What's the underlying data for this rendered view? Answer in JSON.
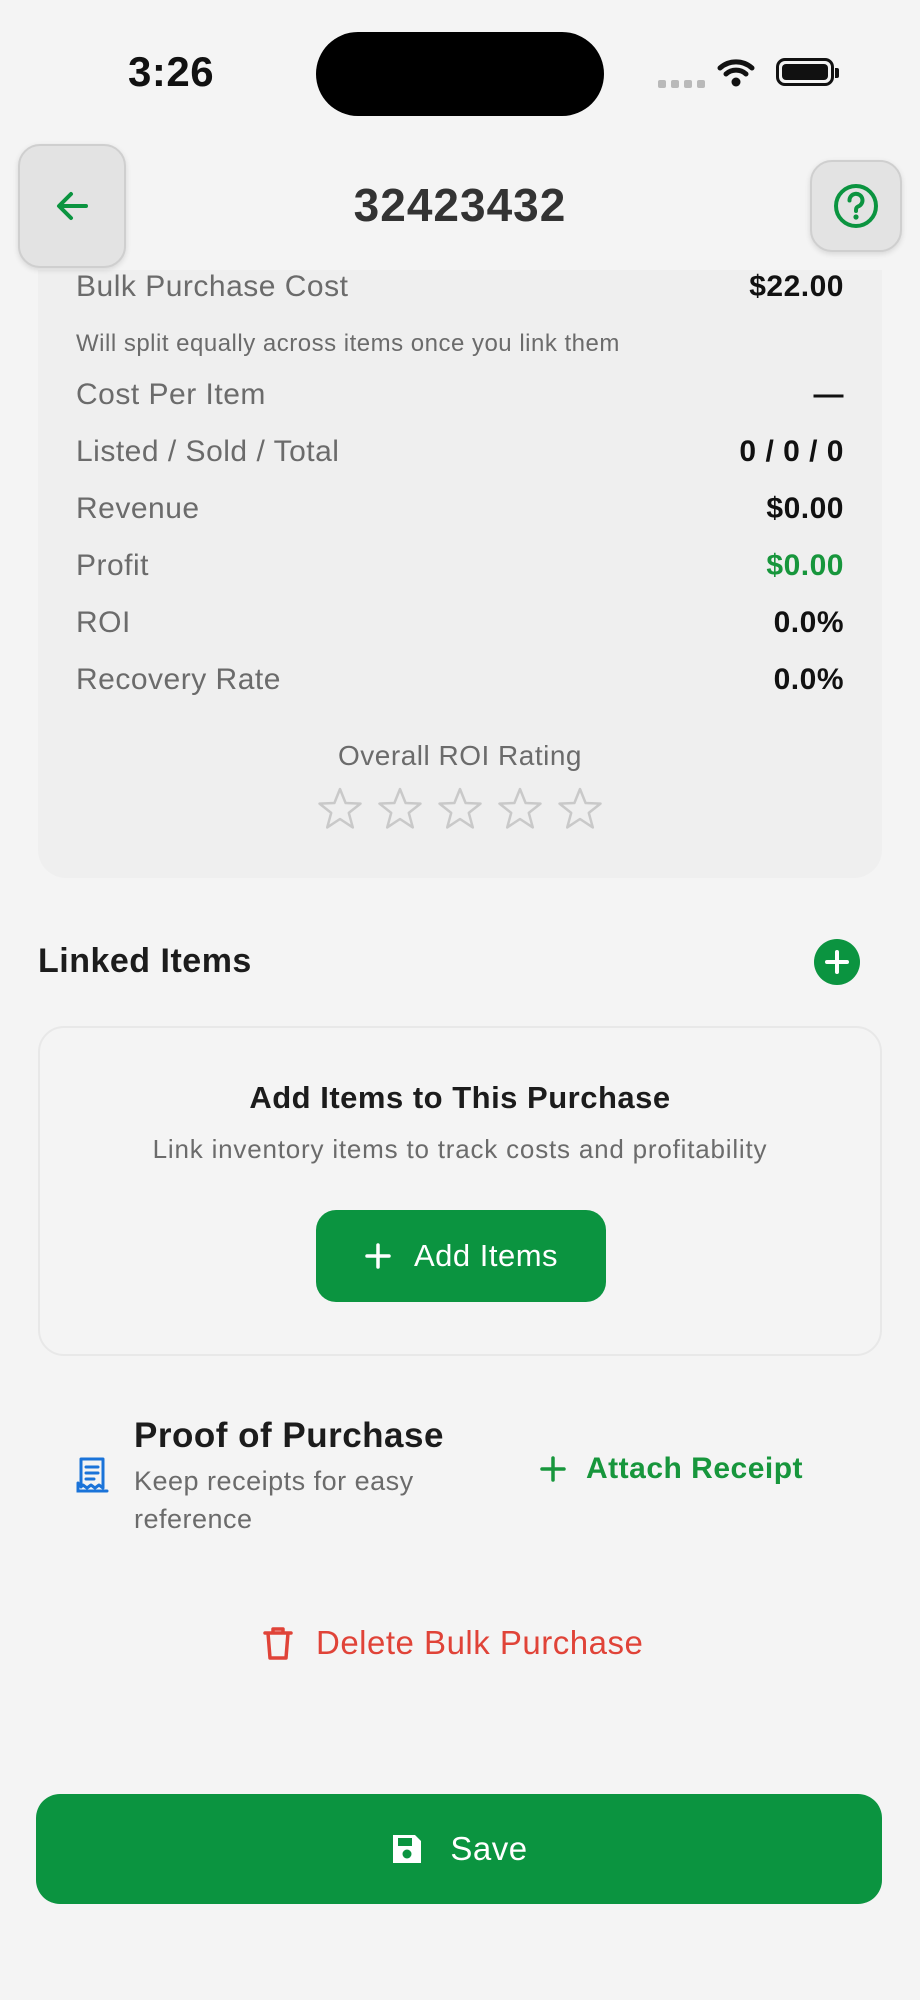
{
  "status_bar": {
    "time": "3:26"
  },
  "header": {
    "title": "32423432",
    "back_icon": "arrow-left-icon",
    "help_icon": "question-circle-icon"
  },
  "colors": {
    "brand_green": "#0b9440",
    "profit_green": "#17963c",
    "danger_red": "#e04338",
    "star_gray": "#c9c9c9"
  },
  "stats": {
    "bulk_cost": {
      "label": "Bulk Purchase Cost",
      "value": "$22.00"
    },
    "split_note": "Will split equally across items once you link them",
    "rows": [
      {
        "label": "Cost Per Item",
        "value": "—"
      },
      {
        "label": "Listed / Sold / Total",
        "value": "0 / 0 / 0"
      },
      {
        "label": "Revenue",
        "value": "$0.00"
      },
      {
        "label": "Profit",
        "value": "$0.00"
      },
      {
        "label": "ROI",
        "value": "0.0%"
      },
      {
        "label": "Recovery Rate",
        "value": "0.0%"
      }
    ],
    "roi_rating": {
      "label": "Overall ROI Rating",
      "stars_filled": 0,
      "stars_total": 5
    }
  },
  "linked_items": {
    "title": "Linked Items",
    "add_icon": "plus-circle-icon",
    "empty": {
      "title": "Add Items to This Purchase",
      "subtitle": "Link inventory items to track costs and profitability",
      "button_label": "Add Items"
    }
  },
  "proof_of_purchase": {
    "icon": "receipt-icon",
    "title": "Proof of Purchase",
    "subtitle": "Keep receipts for easy reference",
    "attach_label": "Attach Receipt"
  },
  "delete": {
    "label": "Delete Bulk Purchase",
    "icon": "trash-icon"
  },
  "save": {
    "label": "Save",
    "icon": "floppy-disk-icon"
  }
}
